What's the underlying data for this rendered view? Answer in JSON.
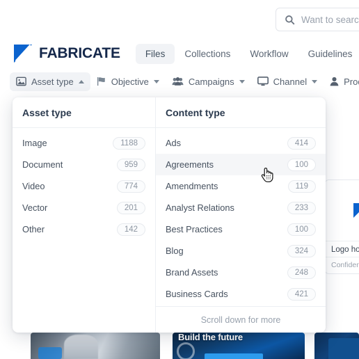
{
  "search": {
    "placeholder": "Want to search",
    "icon": "search-icon"
  },
  "brand": {
    "name": "FABRICATE",
    "logo_color": "#0b63ce",
    "text_color": "#15284b"
  },
  "nav": {
    "tabs": [
      {
        "label": "Files",
        "active": true
      },
      {
        "label": "Collections",
        "active": false
      },
      {
        "label": "Workflow",
        "active": false
      },
      {
        "label": "Guidelines",
        "active": false
      }
    ]
  },
  "filters": [
    {
      "label": "Asset type",
      "icon": "image-icon",
      "caret": "up",
      "active": true
    },
    {
      "label": "Objective",
      "icon": "flag-icon",
      "caret": "down",
      "active": false
    },
    {
      "label": "Campaigns",
      "icon": "people-icon",
      "caret": "down",
      "active": false
    },
    {
      "label": "Channel",
      "icon": "monitor-icon",
      "caret": "down",
      "active": false
    },
    {
      "label": "Produced b",
      "icon": "person-icon",
      "caret": "none",
      "active": false
    }
  ],
  "panel": {
    "columns": [
      {
        "header": "Asset type",
        "options": [
          {
            "label": "Image",
            "count": "1188",
            "hover": false
          },
          {
            "label": "Document",
            "count": "959",
            "hover": false
          },
          {
            "label": "Video",
            "count": "774",
            "hover": false
          },
          {
            "label": "Vector",
            "count": "201",
            "hover": false
          },
          {
            "label": "Other",
            "count": "142",
            "hover": false
          }
        ]
      },
      {
        "header": "Content type",
        "options": [
          {
            "label": "Ads",
            "count": "414",
            "hover": false
          },
          {
            "label": "Agreements",
            "count": "100",
            "hover": true
          },
          {
            "label": "Amendments",
            "count": "119",
            "hover": false
          },
          {
            "label": "Analyst Relations",
            "count": "233",
            "hover": false
          },
          {
            "label": "Best Practices",
            "count": "100",
            "hover": false
          },
          {
            "label": "Blog",
            "count": "324",
            "hover": false
          },
          {
            "label": "Brand Assets",
            "count": "248",
            "hover": false
          },
          {
            "label": "Business Cards",
            "count": "421",
            "hover": false
          }
        ]
      }
    ],
    "scroll_hint": "Scroll down for more"
  },
  "background_card": {
    "logo_word": "F",
    "title": "Logo hor",
    "subtitle": "Confidenti"
  },
  "thumbnails": [
    {
      "name": "robotics-engineer-photo",
      "caption": ""
    },
    {
      "name": "build-the-future-banner",
      "caption": "Build the future"
    },
    {
      "name": "blue-abstract-tile",
      "caption": ""
    }
  ],
  "cursor": {
    "type": "pointer-hand"
  }
}
